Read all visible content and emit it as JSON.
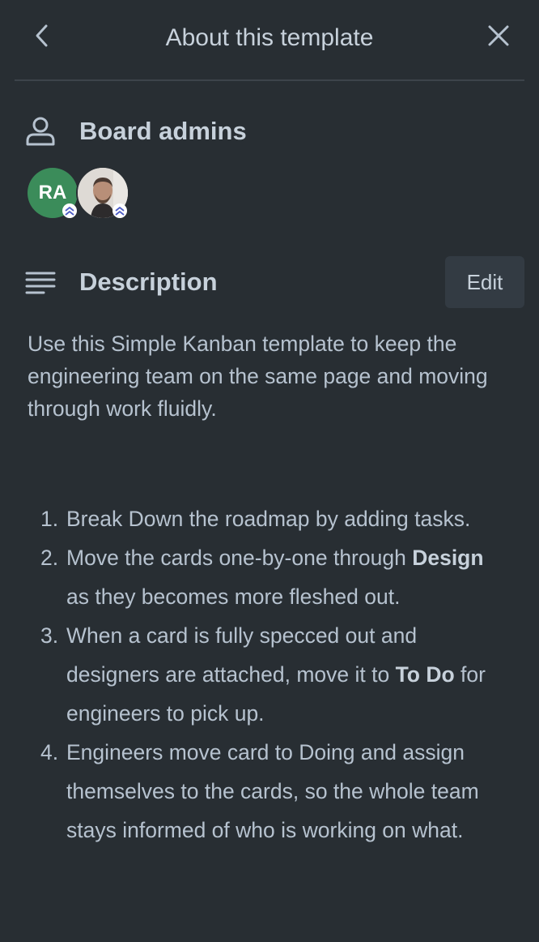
{
  "header": {
    "title": "About this template",
    "back_icon": "chevron-left-icon",
    "close_icon": "close-icon"
  },
  "admins": {
    "title": "Board admins",
    "icon": "person-icon",
    "members": [
      {
        "initials": "RA",
        "color": "#3b8c5a",
        "badge": "admin-chevron-icon"
      },
      {
        "initials": "",
        "type": "photo",
        "badge": "admin-chevron-icon"
      }
    ]
  },
  "description": {
    "title": "Description",
    "icon": "description-lines-icon",
    "edit_label": "Edit",
    "intro": "Use this Simple Kanban template to keep the engineering team on the same page and moving through work fluidly.",
    "steps": [
      {
        "num": "1.",
        "parts": [
          {
            "text": "Break Down the roadmap by adding tasks."
          }
        ]
      },
      {
        "num": "2.",
        "parts": [
          {
            "text": "Move the cards one-by-one through "
          },
          {
            "text": "Design",
            "bold": true
          },
          {
            "text": " as they becomes more fleshed out."
          }
        ]
      },
      {
        "num": "3.",
        "parts": [
          {
            "text": "When a card is fully specced out and designers are attached, move it to "
          },
          {
            "text": "To Do",
            "bold": true
          },
          {
            "text": " for engineers to pick up."
          }
        ]
      },
      {
        "num": "4.",
        "parts": [
          {
            "text": "Engineers move card to Doing and assign themselves to the cards, so the whole team stays informed of who is working on what."
          }
        ]
      }
    ]
  },
  "colors": {
    "background": "#282e33",
    "text": "#b6c2cf",
    "heading": "#c7d1db",
    "button_bg": "#333b43",
    "divider": "#3d444b"
  }
}
